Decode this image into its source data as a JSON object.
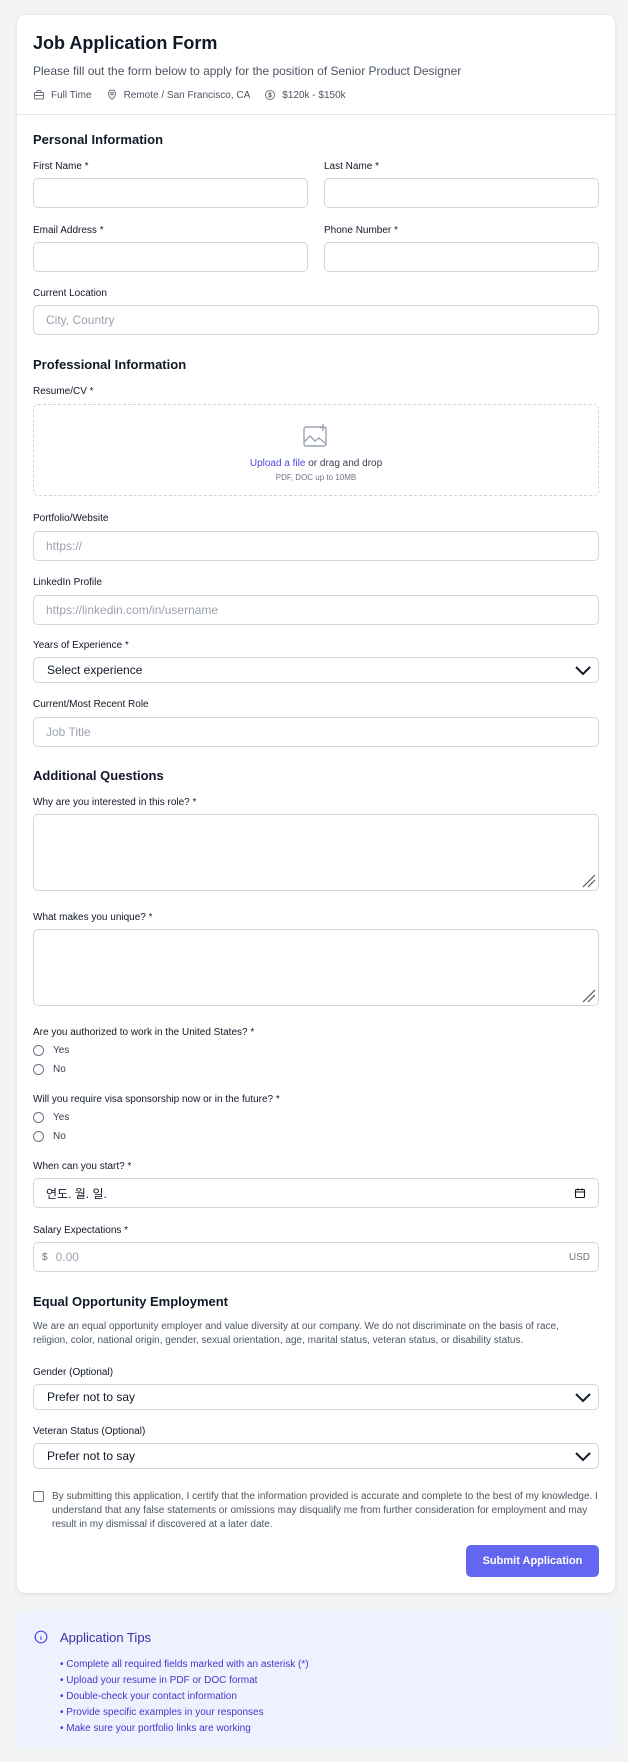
{
  "header": {
    "title": "Job Application Form",
    "subtitle": "Please fill out the form below to apply for the position of Senior Product Designer",
    "meta": [
      "Full Time",
      "Remote / San Francisco, CA",
      "$120k - $150k"
    ]
  },
  "personal": {
    "section_title": "Personal Information",
    "first_name_label": "First Name *",
    "last_name_label": "Last Name *",
    "email_label": "Email Address *",
    "phone_label": "Phone Number *",
    "location_label": "Current Location",
    "location_placeholder": "City, Country"
  },
  "professional": {
    "section_title": "Professional Information",
    "resume_label": "Resume/CV *",
    "upload_link": "Upload a file",
    "upload_rest": " or drag and drop",
    "upload_hint": "PDF, DOC up to 10MB",
    "portfolio_label": "Portfolio/Website",
    "portfolio_placeholder": "https://",
    "linkedin_label": "LinkedIn Profile",
    "linkedin_placeholder": "https://linkedin.com/in/username",
    "experience_label": "Years of Experience *",
    "experience_value": "Select experience",
    "role_label": "Current/Most Recent Role",
    "role_placeholder": "Job Title"
  },
  "additional": {
    "section_title": "Additional Questions",
    "q_interest": "Why are you interested in this role? *",
    "q_unique": "What makes you unique? *",
    "q_authorized": "Are you authorized to work in the United States? *",
    "q_sponsorship": "Will you require visa sponsorship now or in the future? *",
    "yes": "Yes",
    "no": "No",
    "start_label": "When can you start? *",
    "start_value": "연도. 월. 일.",
    "salary_label": "Salary Expectations *",
    "salary_prefix": "$",
    "salary_placeholder": "0.00",
    "salary_suffix": "USD"
  },
  "eeo": {
    "section_title": "Equal Opportunity Employment",
    "statement": "We are an equal opportunity employer and value diversity at our company. We do not discriminate on the basis of race, religion, color, national origin, gender, sexual orientation, age, marital status, veteran status, or disability status.",
    "gender_label": "Gender (Optional)",
    "gender_value": "Prefer not to say",
    "veteran_label": "Veteran Status (Optional)",
    "veteran_value": "Prefer not to say"
  },
  "certify": "By submitting this application, I certify that the information provided is accurate and complete to the best of my knowledge. I understand that any false statements or omissions may disqualify me from further consideration for employment and may result in my dismissal if discovered at a later date.",
  "submit_label": "Submit Application",
  "tips": {
    "title": "Application Tips",
    "items": [
      "• Complete all required fields marked with an asterisk (*)",
      "• Upload your resume in PDF or DOC format",
      "• Double-check your contact information",
      "• Provide specific examples in your responses",
      "• Make sure your portfolio links are working"
    ]
  },
  "colors": {
    "accent": "#6366f1",
    "tips_bg": "#eef2ff",
    "tips_text": "#4338ca"
  }
}
